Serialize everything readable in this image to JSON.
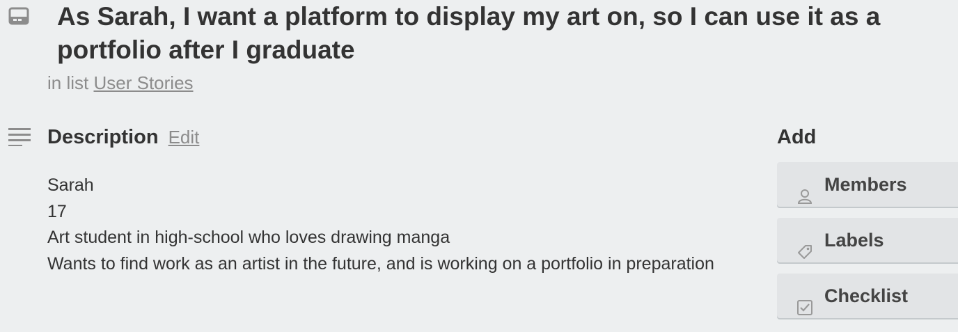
{
  "card": {
    "title": "As Sarah, I want a platform to display my art on, so I can use it as a portfolio after I graduate",
    "in_list_prefix": "in list",
    "list_name": "User Stories"
  },
  "description": {
    "heading": "Description",
    "edit_label": "Edit",
    "lines": [
      "Sarah",
      "17",
      "Art student in high-school who loves drawing manga",
      "Wants to find work as an artist in the future, and is working on a portfolio in preparation"
    ]
  },
  "sidebar": {
    "add_heading": "Add",
    "buttons": [
      {
        "label": "Members",
        "icon": "person-icon"
      },
      {
        "label": "Labels",
        "icon": "tag-icon"
      },
      {
        "label": "Checklist",
        "icon": "checkbox-icon"
      }
    ]
  },
  "colors": {
    "background": "#edeff0",
    "text": "#333333",
    "muted": "#8c8c8c",
    "button_bg": "#e2e4e6"
  }
}
